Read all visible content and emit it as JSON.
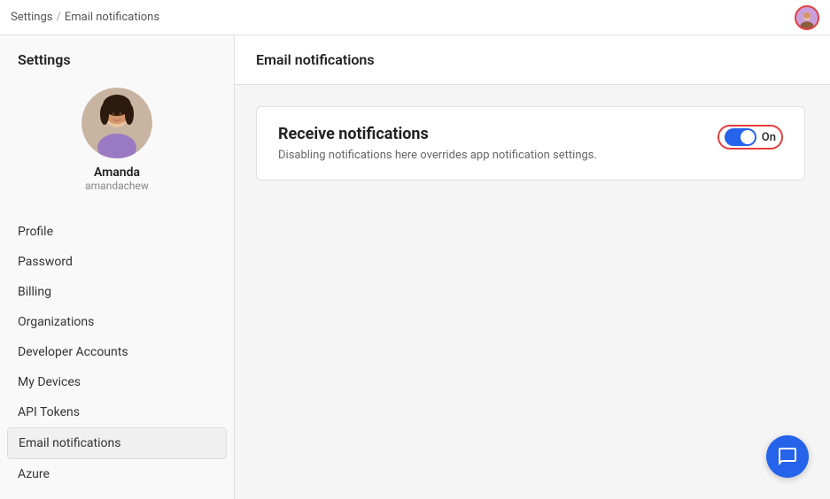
{
  "topbar": {
    "breadcrumb_root": "Settings",
    "breadcrumb_sep": "/",
    "breadcrumb_current": "Email notifications"
  },
  "sidebar": {
    "header": "Settings",
    "user": {
      "name": "Amanda",
      "username": "amandachew"
    },
    "nav_items": [
      {
        "label": "Profile",
        "active": false
      },
      {
        "label": "Password",
        "active": false
      },
      {
        "label": "Billing",
        "active": false
      },
      {
        "label": "Organizations",
        "active": false
      },
      {
        "label": "Developer Accounts",
        "active": false
      },
      {
        "label": "My Devices",
        "active": false
      },
      {
        "label": "API Tokens",
        "active": false
      },
      {
        "label": "Email notifications",
        "active": true
      },
      {
        "label": "Azure",
        "active": false
      }
    ]
  },
  "content": {
    "header": "Email notifications",
    "card": {
      "title": "Receive notifications",
      "description": "Disabling notifications here overrides app notification settings.",
      "toggle_label": "On",
      "toggle_on": true
    }
  }
}
